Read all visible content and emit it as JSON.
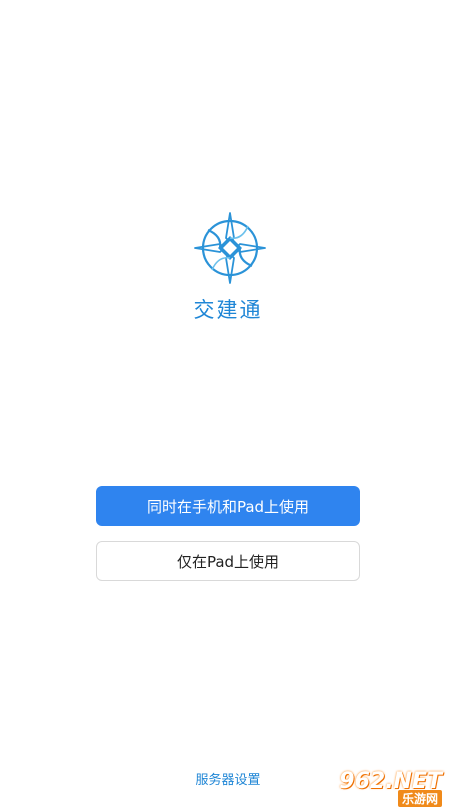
{
  "app": {
    "name": "交建通"
  },
  "actions": {
    "primary_label": "同时在手机和Pad上使用",
    "secondary_label": "仅在Pad上使用"
  },
  "footer": {
    "server_settings": "服务器设置"
  },
  "watermark": {
    "main": "962.NET",
    "sub": "乐游网"
  },
  "colors": {
    "accent": "#2f84ef",
    "brand_text": "#1f86d6",
    "logo": "#2b93d8"
  },
  "icons": {
    "logo": "cross-compass-logo-icon"
  }
}
